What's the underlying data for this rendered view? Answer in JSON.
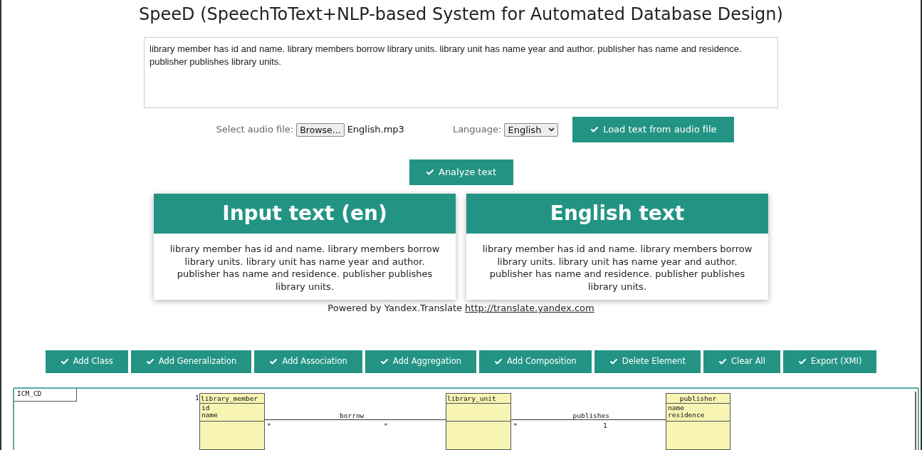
{
  "title": "SpeeD (SpeechToText+NLP-based System for Automated Database Design)",
  "text_input": {
    "value": "library member has id and name. library members borrow library units. library unit has name year and author. publisher has name and residence. publisher publishes library units."
  },
  "audio": {
    "label": "Select audio file:",
    "browse": "Browse...",
    "file": "English.mp3",
    "language_label": "Language:",
    "language": "English",
    "load_button": "Load text from audio file"
  },
  "analyze_button": "Analyze text",
  "cards": [
    {
      "title": "Input text (en)",
      "body": "library member has id and name. library members borrow library units. library unit has name year and author. publisher has name and residence. publisher publishes library units."
    },
    {
      "title": "English text",
      "body": "library member has id and name. library members borrow library units. library unit has name year and author. publisher has name and residence. publisher publishes library units."
    }
  ],
  "powered": {
    "text": "Powered by Yandex.Translate",
    "link": "http://translate.yandex.com"
  },
  "toolbar": [
    "Add Class",
    "Add Generalization",
    "Add Association",
    "Add Aggregation",
    "Add Composition",
    "Delete Element",
    "Clear All",
    "Export (XMI)"
  ],
  "diagram": {
    "tab": "ICM_CD",
    "floating_label": "1",
    "classes": [
      {
        "name": "library_member",
        "attributes": [
          "id",
          "name"
        ]
      },
      {
        "name": "library_unit"
      },
      {
        "name": "publisher",
        "attributes": [
          "name",
          "residence"
        ]
      }
    ],
    "associations": [
      {
        "label": "borrow",
        "source_mult": "*",
        "target_mult": "*"
      },
      {
        "label": "publishes",
        "source_mult": "*",
        "target_mult": "1"
      }
    ]
  }
}
